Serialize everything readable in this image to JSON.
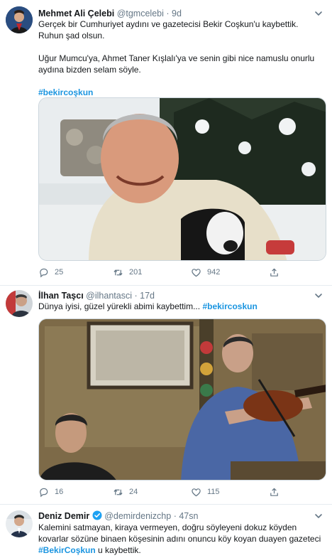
{
  "tweets": [
    {
      "name": "Mehmet Ali Çelebi",
      "handle": "@tgmcelebi",
      "dot": "·",
      "time": "9d",
      "text1": "Gerçek bir Cumhuriyet aydını ve gazetecisi Bekir Coşkun'u kaybettik.  Ruhun şad olsun.",
      "text2": "Uğur Mumcu'ya, Ahmet Taner Kışlalı'ya ve senin gibi nice namuslu onurlu aydına bizden selam söyle.",
      "hashtag": "#bekircoşkun",
      "reply_count": "25",
      "retweet_count": "201",
      "like_count": "942"
    },
    {
      "name": "İlhan Taşcı",
      "handle": "@ilhantasci",
      "dot": "·",
      "time": "17d",
      "text": "Dünya iyisi, güzel yürekli abimi kaybettim...",
      "hashtag": "#bekircoskun",
      "reply_count": "16",
      "retweet_count": "24",
      "like_count": "115"
    },
    {
      "name": "Deniz Demir",
      "handle": "@demirdenizchp",
      "dot": "·",
      "time": "47sn",
      "text_a": "Kalemini satmayan, kiraya vermeyen, doğru söyleyeni dokuz köyden kovarlar sözüne binaen köşesinin adını onuncu köy koyan duayen gazeteci",
      "hashtag": "#BekirCoşkun",
      "text_b": "u kaybettik."
    }
  ],
  "colors": {
    "link": "#1b95e0",
    "secondary": "#657786",
    "verified": "#1da1f2",
    "divider": "#e6ecf0"
  },
  "icons": [
    "reply-icon",
    "retweet-icon",
    "like-icon",
    "share-icon",
    "chevron-down-icon",
    "verified-badge-icon"
  ]
}
